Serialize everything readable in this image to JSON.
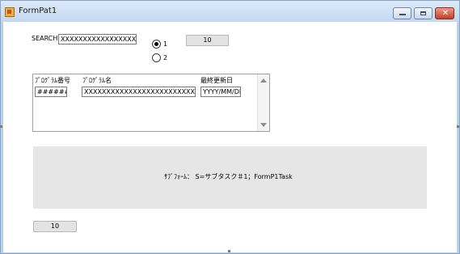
{
  "window": {
    "title": "FormPat1",
    "close_glyph": "✕"
  },
  "search": {
    "label": "SEARCH",
    "value": "XXXXXXXXXXXXXXXXXXXXXXXXX",
    "count": "10"
  },
  "radios": [
    {
      "label": "1",
      "checked": true
    },
    {
      "label": "2",
      "checked": false
    }
  ],
  "list": {
    "headers": [
      "ﾌﾟﾛｸﾞﾗﾑ番号",
      "ﾌﾟﾛｸﾞﾗﾑ名",
      "最終更新日"
    ],
    "row": {
      "number": "########",
      "name": "XXXXXXXXXXXXXXXXXXXXXXXXXXXXXXXXXXXXXXXX",
      "date": "YYYY/MM/DD"
    }
  },
  "subform": {
    "text": "ｻﾌﾞﾌｫｰﾑ： S=サブタスク＃1；FormP1Task"
  },
  "footer": {
    "count": "10"
  },
  "colors": {
    "titlebar": "#c3d8f0",
    "panel": "#e6e6e6",
    "close_button": "#c1412a"
  },
  "icons": [
    "app-icon",
    "minimize-icon",
    "maximize-icon",
    "close-icon",
    "scroll-up-icon",
    "scroll-down-icon"
  ]
}
